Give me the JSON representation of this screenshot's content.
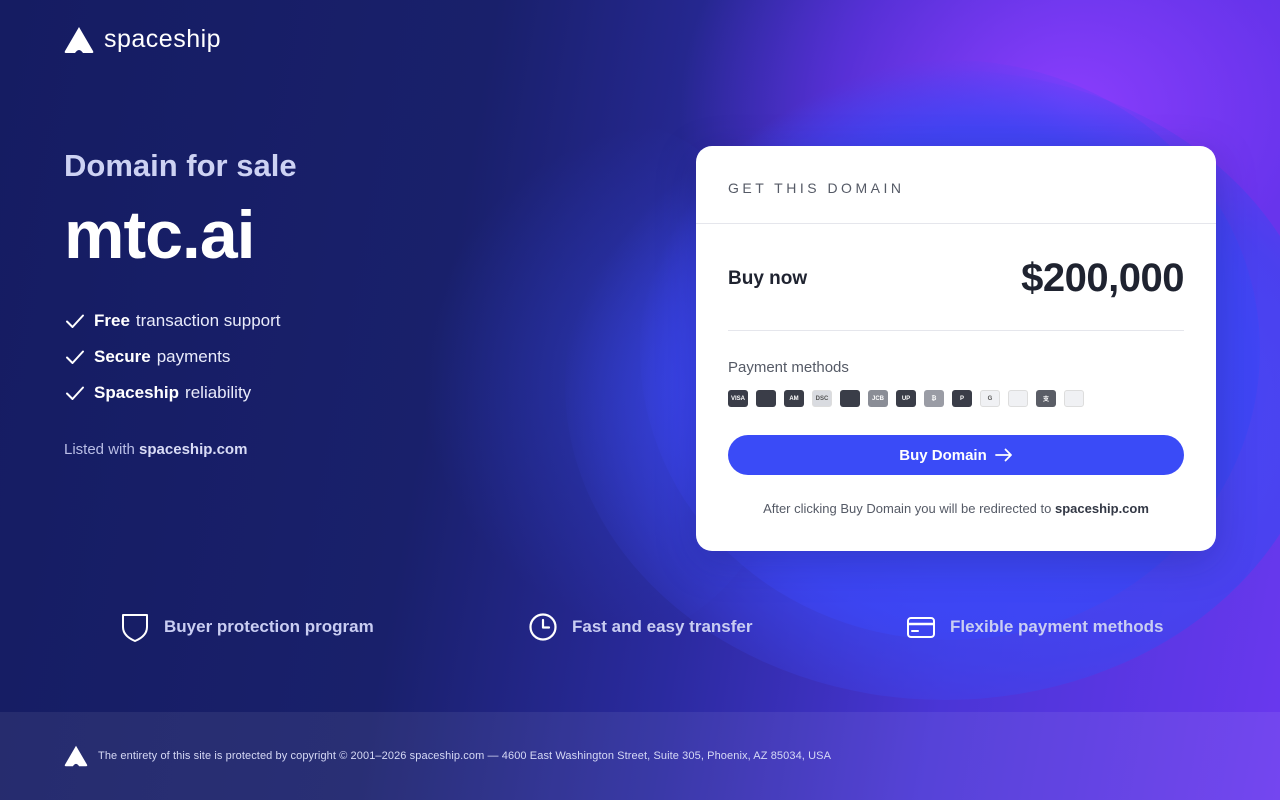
{
  "brand": {
    "name": "spaceship"
  },
  "hero": {
    "kicker": "Domain for sale",
    "domain": "mtc.ai"
  },
  "features": [
    {
      "bold": "Free",
      "rest": "transaction support"
    },
    {
      "bold": "Secure",
      "rest": "payments"
    },
    {
      "bold": "Spaceship",
      "rest": "reliability"
    }
  ],
  "listed": {
    "prefix": "Listed with",
    "site": "spaceship.com"
  },
  "card": {
    "header": "GET THIS DOMAIN",
    "buy_now": "Buy now",
    "price": "$200,000",
    "payment_label": "Payment methods",
    "payment_icons": [
      {
        "name": "visa-icon",
        "text": "VISA",
        "color": "#3a3d48"
      },
      {
        "name": "mastercard-icon",
        "text": "",
        "color": "#3a3d48"
      },
      {
        "name": "amex-icon",
        "text": "AM",
        "color": "#3a3d48"
      },
      {
        "name": "discover-icon",
        "text": "DSC",
        "color": "#d9dbe0"
      },
      {
        "name": "diners-club-icon",
        "text": "",
        "color": "#3a3d48"
      },
      {
        "name": "jcb-icon",
        "text": "JCB",
        "color": "#8a8d96"
      },
      {
        "name": "unionpay-icon",
        "text": "UP",
        "color": "#3a3d48"
      },
      {
        "name": "bitcoin-icon",
        "text": "₿",
        "color": "#9a9ca5"
      },
      {
        "name": "paypal-icon",
        "text": "P",
        "color": "#3a3d48"
      },
      {
        "name": "google-pay-icon",
        "text": "G",
        "color": "#f0f1f4"
      },
      {
        "name": "apple-pay-icon",
        "text": "",
        "color": "#f0f1f4"
      },
      {
        "name": "alipay-icon",
        "text": "支",
        "color": "#5a5d66"
      },
      {
        "name": "bank-transfer-icon",
        "text": "",
        "color": "#f0f1f4"
      }
    ],
    "cta_label": "Buy Domain",
    "redirect_text": "After clicking Buy Domain you will be redirected to",
    "redirect_site": "spaceship.com"
  },
  "benefits": [
    {
      "label": "Buyer protection program"
    },
    {
      "label": "Fast and easy transfer"
    },
    {
      "label": "Flexible payment methods"
    }
  ],
  "footer": {
    "copyright": "The entirety of this site is protected by copyright © 2001–2026 spaceship.com — 4600 East Washington Street, Suite 305, Phoenix, AZ 85034, USA"
  },
  "colors": {
    "accent": "#3a4bf7",
    "background": "#161d63",
    "card": "#ffffff"
  }
}
